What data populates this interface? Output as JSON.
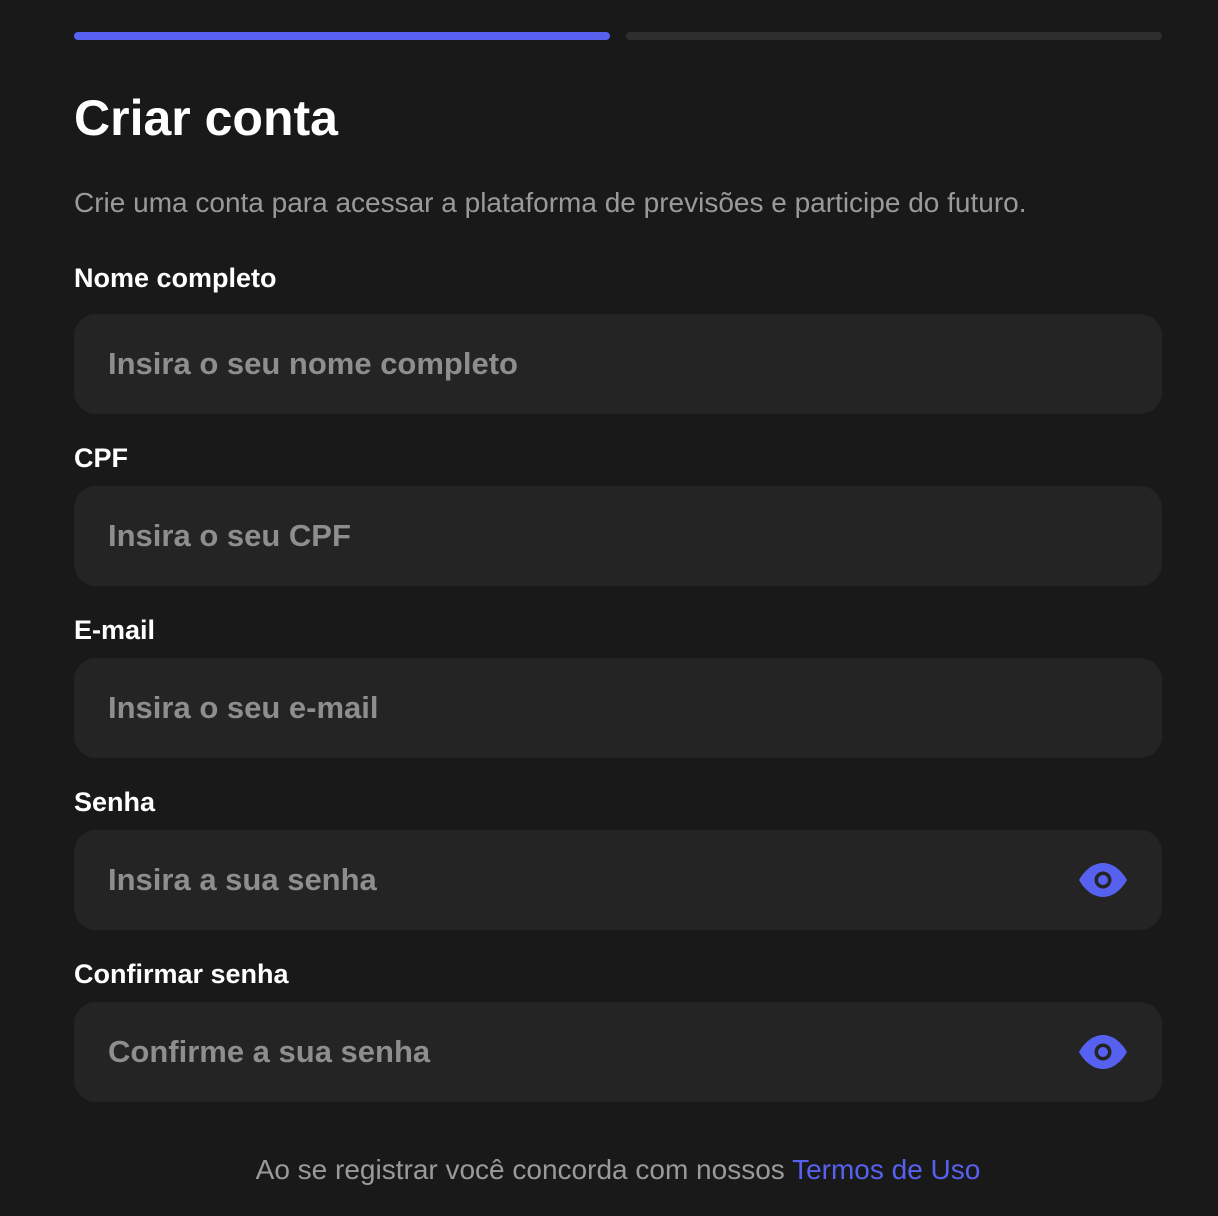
{
  "progress": {
    "current_step": 1,
    "total_steps": 2,
    "active_color": "#5761f0",
    "inactive_color": "#2e2e2e"
  },
  "header": {
    "title": "Criar conta",
    "subtitle": "Crie uma conta para acessar a plataforma de previsões e participe do futuro."
  },
  "form": {
    "full_name": {
      "label": "Nome completo",
      "placeholder": "Insira o seu nome completo",
      "value": ""
    },
    "cpf": {
      "label": "CPF",
      "placeholder": "Insira o seu CPF",
      "value": ""
    },
    "email": {
      "label": "E-mail",
      "placeholder": "Insira o seu e-mail",
      "value": ""
    },
    "password": {
      "label": "Senha",
      "placeholder": "Insira a sua senha",
      "value": "",
      "toggle_icon": "eye-icon"
    },
    "confirm_password": {
      "label": "Confirmar senha",
      "placeholder": "Confirme a sua senha",
      "value": "",
      "toggle_icon": "eye-icon"
    }
  },
  "footer": {
    "terms_text": "Ao se registrar você concorda com nossos",
    "terms_link": "Termos de Uso"
  },
  "colors": {
    "background": "#191919",
    "field_background": "#242424",
    "accent": "#5761f0",
    "muted_text": "#9a9a9a"
  }
}
